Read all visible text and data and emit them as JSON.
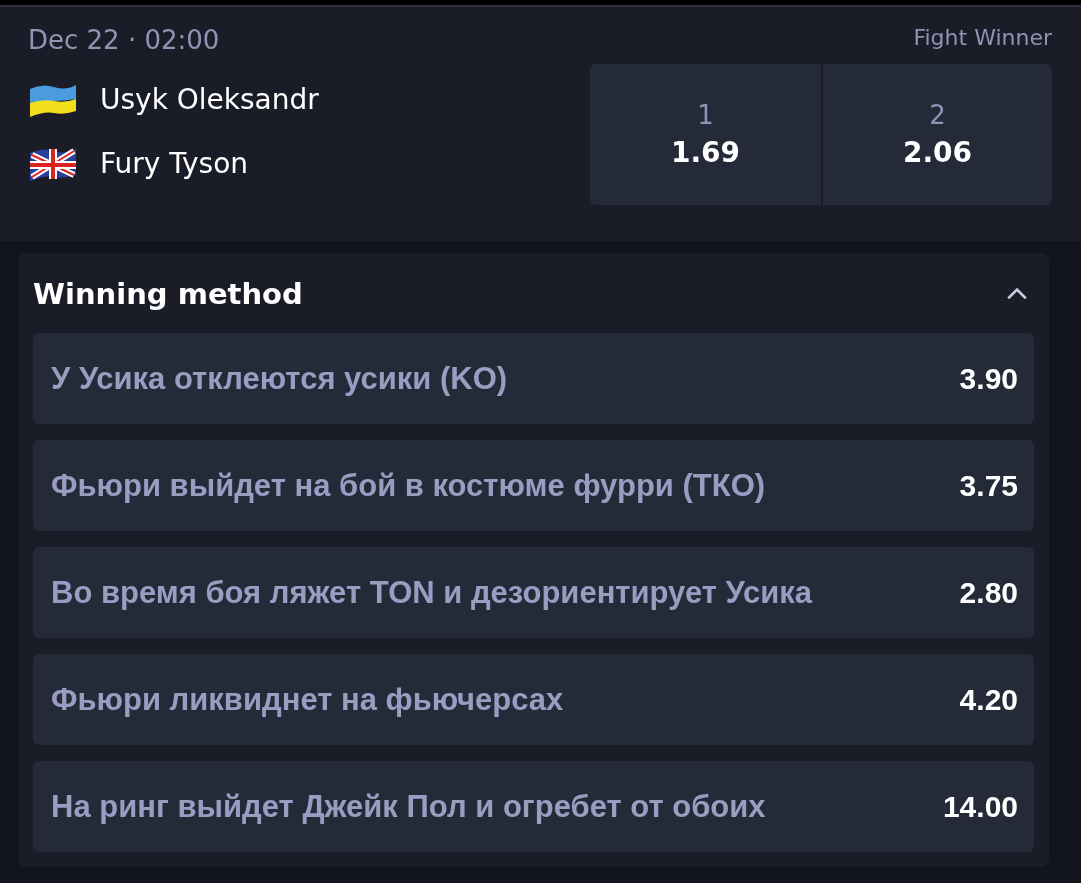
{
  "event": {
    "date": "Dec 22 · 02:00",
    "market": "Fight Winner",
    "fighters": [
      {
        "name": "Usyk Oleksandr",
        "kind": "ua"
      },
      {
        "name": "Fury Tyson",
        "kind": "gb"
      }
    ],
    "odds": [
      {
        "label": "1",
        "value": "1.69"
      },
      {
        "label": "2",
        "value": "2.06"
      }
    ]
  },
  "section": {
    "title": "Winning method",
    "expanded": true,
    "options": [
      {
        "label": "У Усика отклеются усики (KO)",
        "odds": "3.90"
      },
      {
        "label": "Фьюри выйдет на бой в костюме фурри (ТКО)",
        "odds": "3.75"
      },
      {
        "label": "Во время боя ляжет TON и дезориентирует Усика",
        "odds": "2.80"
      },
      {
        "label": "Фьюри ликвиднет на фьючерсах",
        "odds": "4.20"
      },
      {
        "label": "На ринг выйдет Джейк Пол и огребет от обоих",
        "odds": "14.00"
      }
    ]
  }
}
